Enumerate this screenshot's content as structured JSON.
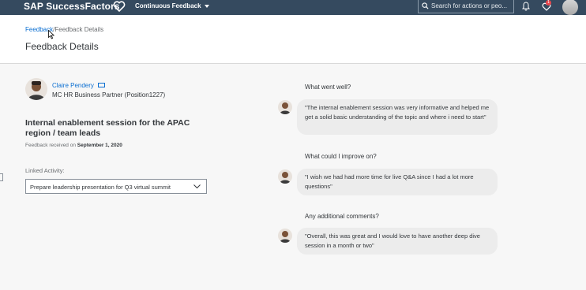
{
  "topbar": {
    "brand": "SAP SuccessFactors",
    "module": "Continuous Feedback",
    "search_placeholder": "Search for actions or peo...",
    "notification_count": "1"
  },
  "breadcrumb": {
    "link": "Feedback",
    "separator": "/",
    "current": "Feedback Details"
  },
  "page_title": "Feedback Details",
  "person": {
    "name": "Claire Pendery",
    "role": "MC HR Business Partner (Position1227)"
  },
  "subject": "Internal enablement session for the APAC region / team leads",
  "received": {
    "prefix": "Feedback received on",
    "date": "September 1, 2020"
  },
  "linked_activity": {
    "label": "Linked Activity:",
    "value": "Prepare leadership presentation for Q3 virtual summit"
  },
  "feedback": [
    {
      "question": "What went well?",
      "answer": "\"The internal enablement session was very informative and helped me get a solid basic understanding of the topic and where i need to start\""
    },
    {
      "question": "What could I improve on?",
      "answer": "\"I wish we had had more time for live Q&A since I had a lot more questions\""
    },
    {
      "question": "Any additional comments?",
      "answer": "\"Overall, this was great and I would love to have another deep dive session in a month or two\""
    }
  ]
}
